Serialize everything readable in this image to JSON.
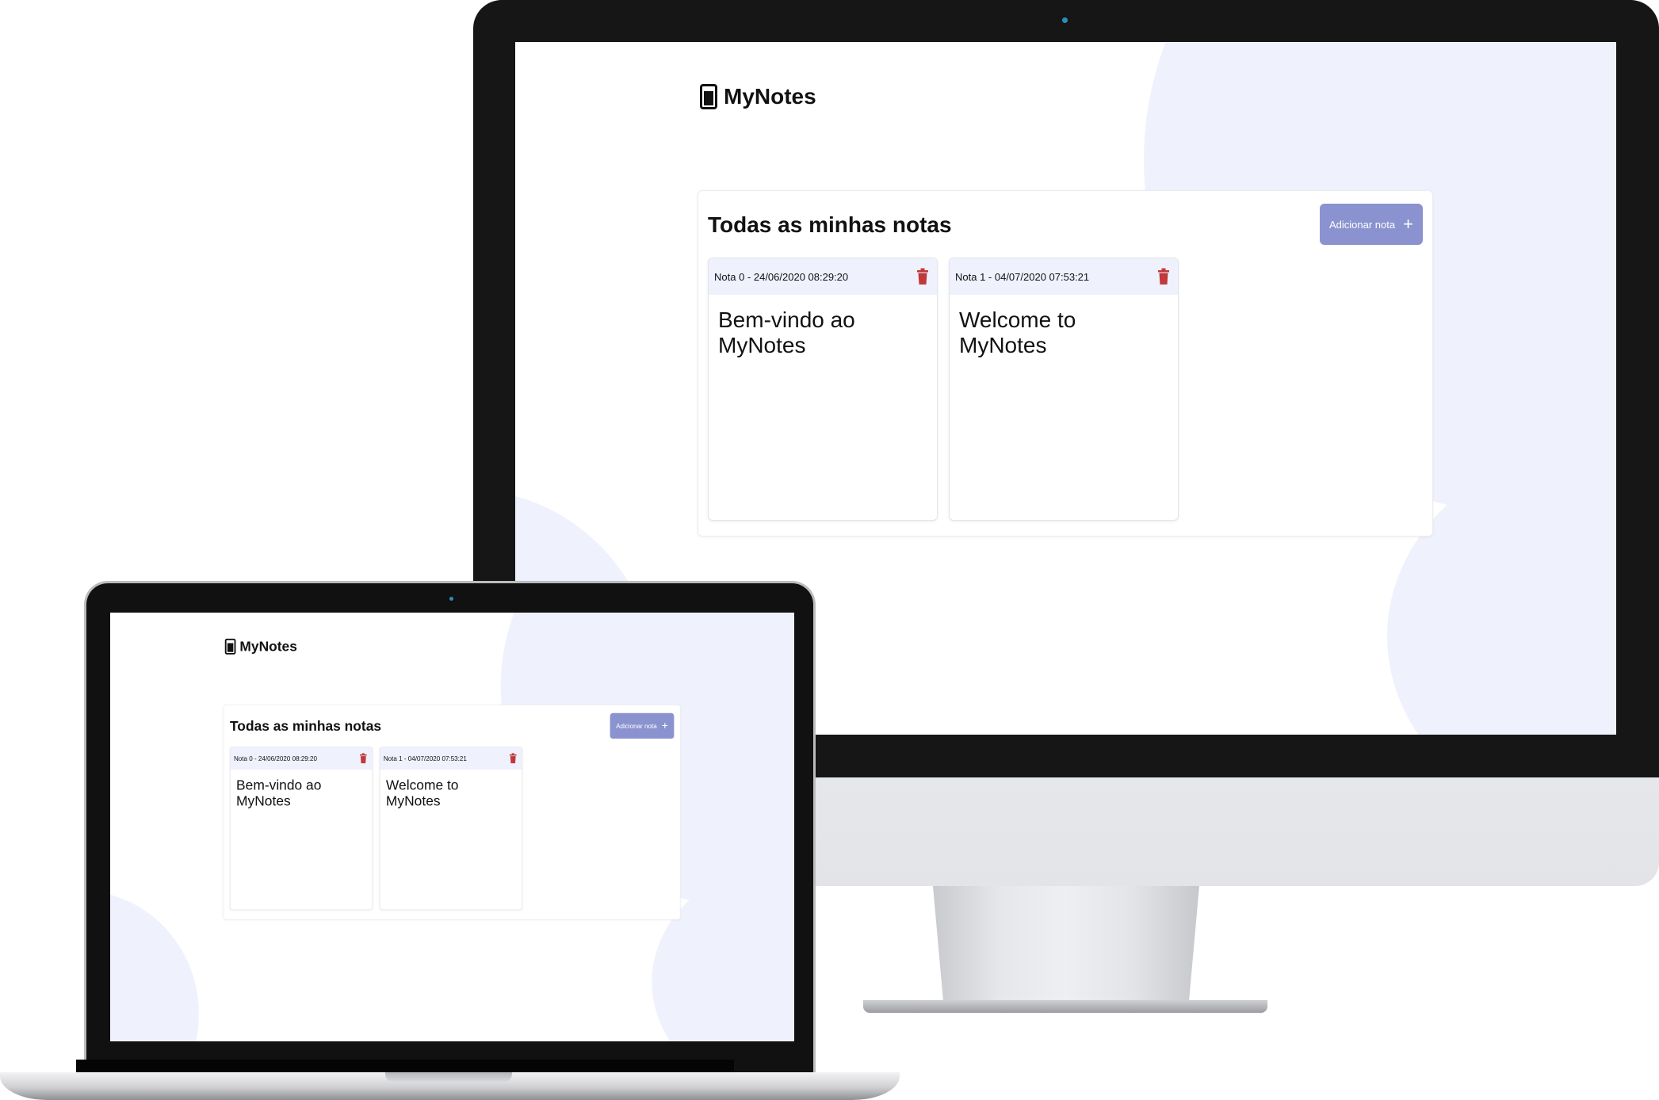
{
  "app": {
    "logo_text": "MyNotes",
    "panel_title": "Todas as minhas notas",
    "add_button_label": "Adicionar nota",
    "add_button_icon": "+",
    "notes": [
      {
        "header": "Nota 0 - 24/06/2020 08:29:20",
        "body": "Bem-vindo ao MyNotes"
      },
      {
        "header": "Nota 1 - 04/07/2020 07:53:21",
        "body": "Welcome to MyNotes"
      }
    ]
  },
  "colors": {
    "accent": "#8a93cf",
    "note_header_bg": "#eff1fc",
    "delete_icon": "#c0393b",
    "background_blob": "#eff1fc"
  },
  "icons": {
    "logo": "notebook-icon",
    "delete": "trash-icon",
    "add": "plus-icon"
  }
}
